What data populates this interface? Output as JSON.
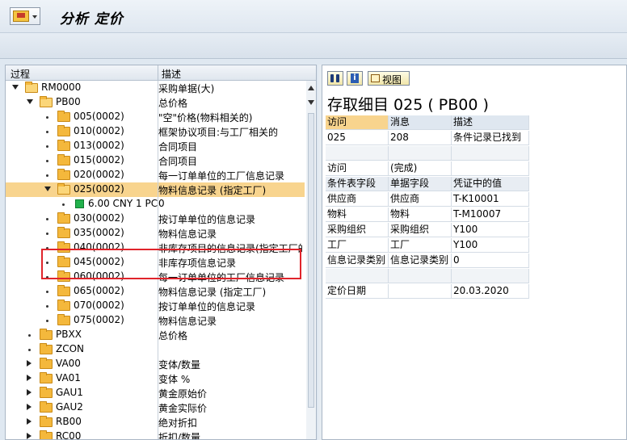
{
  "window": {
    "title": "分析 定价"
  },
  "tree": {
    "headers": {
      "col1": "过程",
      "col2": "描述"
    },
    "rows": [
      {
        "level": 1,
        "exp": "down",
        "icon": "folder-open",
        "label": "RM0000",
        "desc": "采购单据(大)"
      },
      {
        "level": 2,
        "exp": "down",
        "icon": "folder-open",
        "label": "PB00",
        "desc": "总价格"
      },
      {
        "level": 3,
        "exp": "dot",
        "icon": "folder",
        "label": "005(0002)",
        "desc": "\"空\"价格(物料相关的)"
      },
      {
        "level": 3,
        "exp": "dot",
        "icon": "folder",
        "label": "010(0002)",
        "desc": "框架协议项目:与工厂相关的"
      },
      {
        "level": 3,
        "exp": "dot",
        "icon": "folder",
        "label": "013(0002)",
        "desc": "合同项目"
      },
      {
        "level": 3,
        "exp": "dot",
        "icon": "folder",
        "label": "015(0002)",
        "desc": "合同项目"
      },
      {
        "level": 3,
        "exp": "dot",
        "icon": "folder",
        "label": "020(0002)",
        "desc": "每一订单单位的工厂信息记录"
      },
      {
        "level": 3,
        "exp": "down",
        "icon": "folder-open",
        "label": "025(0002)",
        "desc": "物料信息记录 (指定工厂)",
        "selected": true
      },
      {
        "level": 4,
        "exp": "dot",
        "icon": "green-square",
        "label": "6.00 CNY 1 PC",
        "desc": "0"
      },
      {
        "level": 3,
        "exp": "dot",
        "icon": "folder",
        "label": "030(0002)",
        "desc": "按订单单位的信息记录"
      },
      {
        "level": 3,
        "exp": "dot",
        "icon": "folder",
        "label": "035(0002)",
        "desc": "物料信息记录"
      },
      {
        "level": 3,
        "exp": "dot",
        "icon": "folder",
        "label": "040(0002)",
        "desc": "非库存项目的信息记录(指定工厂的)"
      },
      {
        "level": 3,
        "exp": "dot",
        "icon": "folder",
        "label": "045(0002)",
        "desc": "非库存项信息记录"
      },
      {
        "level": 3,
        "exp": "dot",
        "icon": "folder",
        "label": "060(0002)",
        "desc": "每一订单单位的工厂信息记录"
      },
      {
        "level": 3,
        "exp": "dot",
        "icon": "folder",
        "label": "065(0002)",
        "desc": "物料信息记录 (指定工厂)"
      },
      {
        "level": 3,
        "exp": "dot",
        "icon": "folder",
        "label": "070(0002)",
        "desc": "按订单单位的信息记录"
      },
      {
        "level": 3,
        "exp": "dot",
        "icon": "folder",
        "label": "075(0002)",
        "desc": "物料信息记录"
      },
      {
        "level": 2,
        "exp": "dot",
        "icon": "folder",
        "label": "PBXX",
        "desc": "总价格"
      },
      {
        "level": 2,
        "exp": "dot",
        "icon": "folder",
        "label": "ZCON",
        "desc": ""
      },
      {
        "level": 2,
        "exp": "right",
        "icon": "folder",
        "label": "VA00",
        "desc": "变体/数量"
      },
      {
        "level": 2,
        "exp": "right",
        "icon": "folder",
        "label": "VA01",
        "desc": "变体 %"
      },
      {
        "level": 2,
        "exp": "right",
        "icon": "folder",
        "label": "GAU1",
        "desc": "黄金原始价"
      },
      {
        "level": 2,
        "exp": "right",
        "icon": "folder",
        "label": "GAU2",
        "desc": "黄金实际价"
      },
      {
        "level": 2,
        "exp": "right",
        "icon": "folder",
        "label": "RB00",
        "desc": "绝对折扣"
      },
      {
        "level": 2,
        "exp": "right",
        "icon": "folder",
        "label": "RC00",
        "desc": "折扣/数量"
      }
    ]
  },
  "detail": {
    "view_button": "视图",
    "title": "存取细目 025 ( PB00 )",
    "headers": [
      "访问",
      "消息",
      "描述"
    ],
    "rows": [
      {
        "a": "025",
        "b": "208",
        "c": "条件记录已找到"
      },
      {
        "a": "",
        "b": "",
        "c": "",
        "blank": true
      },
      {
        "a": "访问",
        "b": "(完成)",
        "c": ""
      },
      {
        "a": "条件表字段",
        "b": "单据字段",
        "c": "凭证中的值",
        "hdr": true
      },
      {
        "a": "供应商",
        "b": "供应商",
        "c": "T-K10001"
      },
      {
        "a": "物料",
        "b": "物料",
        "c": "T-M10007"
      },
      {
        "a": "采购组织",
        "b": "采购组织",
        "c": "Y100"
      },
      {
        "a": "工厂",
        "b": "工厂",
        "c": "Y100"
      },
      {
        "a": "信息记录类别",
        "b": "信息记录类别",
        "c": "0"
      },
      {
        "a": "",
        "b": "",
        "c": "",
        "blank": true
      },
      {
        "a": "定价日期",
        "b": "",
        "c": "20.03.2020"
      }
    ]
  }
}
